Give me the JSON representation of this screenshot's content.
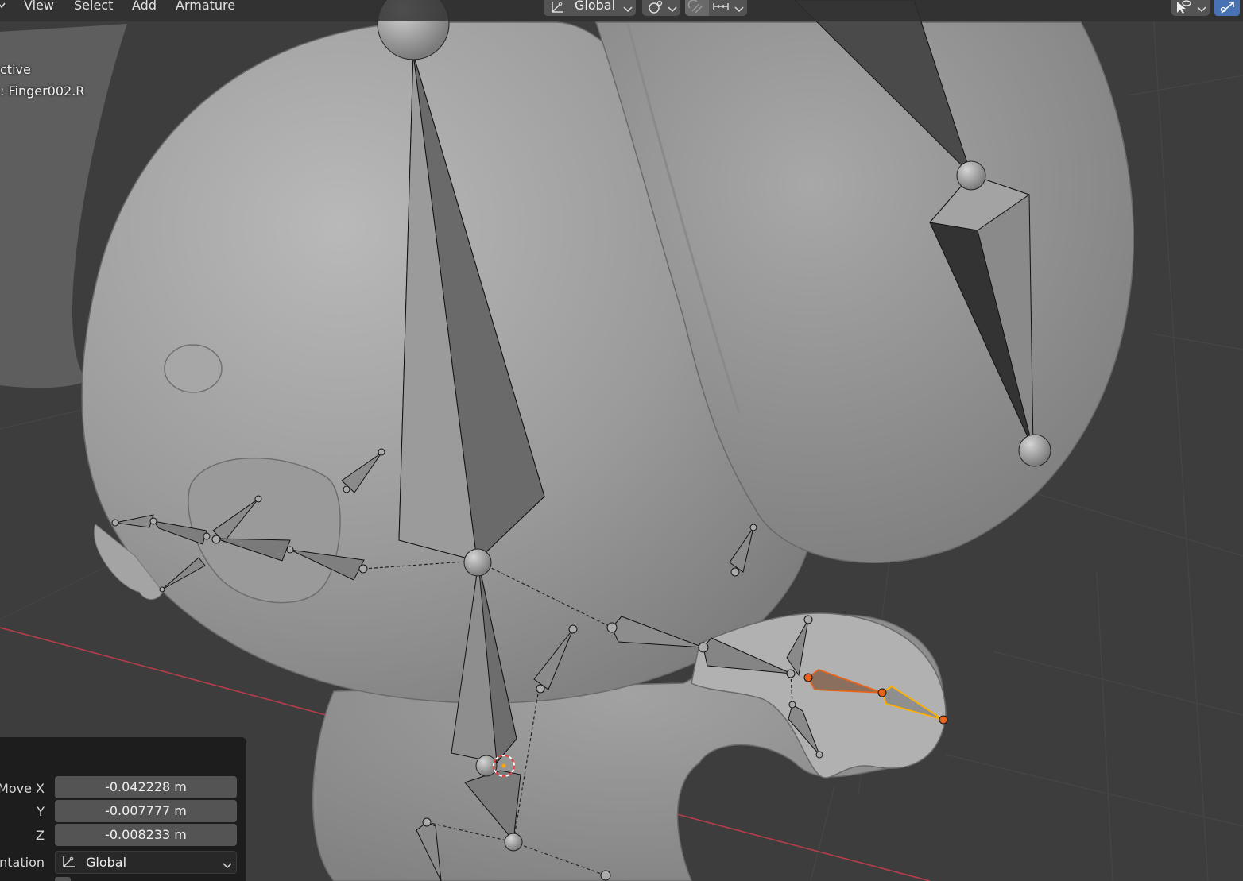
{
  "header": {
    "menus": [
      "View",
      "Select",
      "Add",
      "Armature"
    ],
    "orientation_label": "Global"
  },
  "overlay": {
    "mode_line": "ctive",
    "bone_line": ": Finger002.R"
  },
  "redo_panel": {
    "move_x_label": "Move X",
    "move_x_value": "-0.042228 m",
    "y_label": "Y",
    "y_value": "-0.007777 m",
    "z_label": "Z",
    "z_value": "-0.008233 m",
    "orientation_label": "entation",
    "orientation_value": "Global"
  },
  "colors": {
    "selected_bone_active": "#ffb000",
    "selected_bone": "#e8641c",
    "axis_x": "#c8404e",
    "background": "#3d3d3d",
    "mesh": "#9c9c9c"
  }
}
